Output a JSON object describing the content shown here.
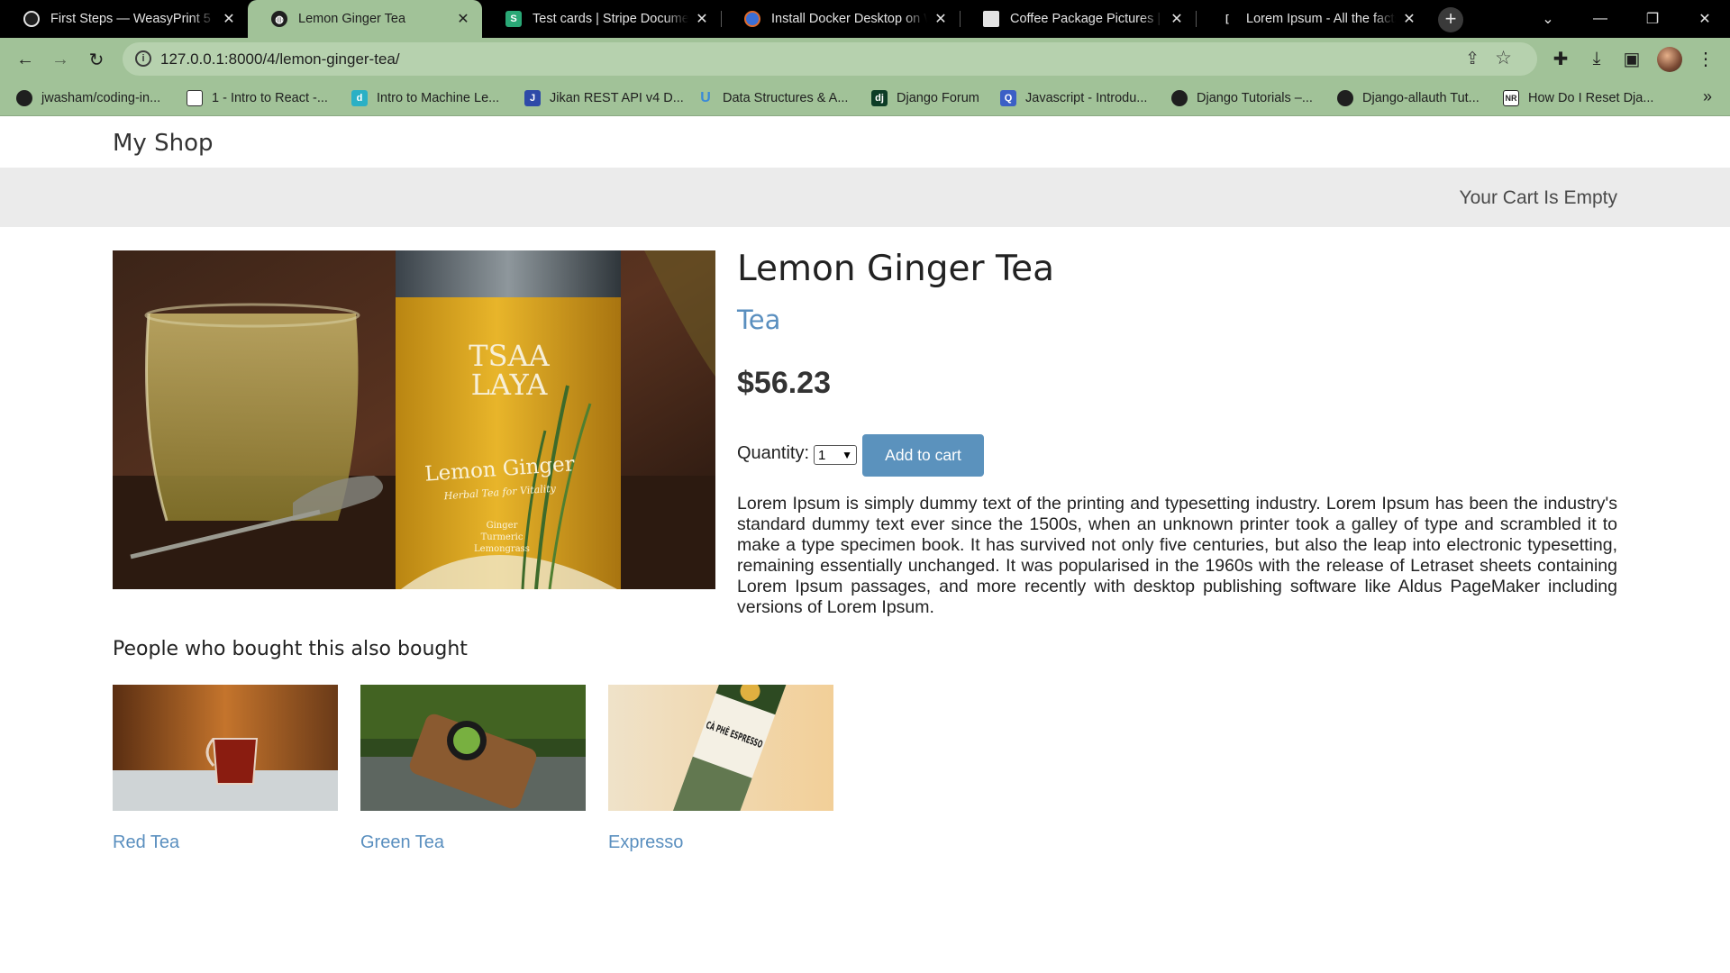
{
  "browser": {
    "tabs": [
      {
        "title": "First Steps — WeasyPrint 5",
        "active": false
      },
      {
        "title": "Lemon Ginger Tea",
        "active": true
      },
      {
        "title": "Test cards | Stripe Documen",
        "active": false
      },
      {
        "title": "Install Docker Desktop on W",
        "active": false
      },
      {
        "title": "Coffee Package Pictures | D",
        "active": false
      },
      {
        "title": "Lorem Ipsum - All the facts",
        "active": false
      }
    ],
    "url": "127.0.0.1:8000/4/lemon-ginger-tea/",
    "bookmarks": [
      "jwasham/coding-in...",
      "1 - Intro to React -...",
      "Intro to Machine Le...",
      "Jikan REST API v4 D...",
      "Data Structures & A...",
      "Django Forum",
      "Javascript - Introdu...",
      "Django Tutorials –...",
      "Django-allauth Tut...",
      "How Do I Reset Dja..."
    ],
    "theme_color": "#a1c298"
  },
  "site": {
    "brand": "My Shop",
    "cart_status": "Your Cart Is Empty"
  },
  "product": {
    "name": "Lemon Ginger Tea",
    "category": "Tea",
    "price": "$56.23",
    "quantity_label": "Quantity:",
    "quantity_value": "1",
    "add_to_cart_label": "Add to cart",
    "description": "Lorem Ipsum is simply dummy text of the printing and typesetting industry. Lorem Ipsum has been the industry's standard dummy text ever since the 1500s, when an unknown printer took a galley of type and scrambled it to make a type specimen book. It has survived not only five centuries, but also the leap into electronic typesetting, remaining essentially unchanged. It was popularised in the 1960s with the release of Letraset sheets containing Lorem Ipsum passages, and more recently with desktop publishing software like Aldus PageMaker including versions of Lorem Ipsum.",
    "image_text": {
      "brand_line1": "TSAA",
      "brand_line2": "LAYA",
      "product_line": "Lemon Ginger",
      "tagline": "Herbal Tea for Vitality",
      "ingredients": [
        "Ginger",
        "Turmeric",
        "Lemongrass"
      ]
    }
  },
  "recommendations": {
    "heading": "People who bought this also bought",
    "items": [
      {
        "name": "Red Tea"
      },
      {
        "name": "Green Tea"
      },
      {
        "name": "Expresso",
        "image_text": "CÀ PHÊ ESPRESSO"
      }
    ]
  },
  "colors": {
    "link": "#5a8fbf",
    "button": "#5b92bd",
    "cart_bar": "#ebebeb"
  }
}
